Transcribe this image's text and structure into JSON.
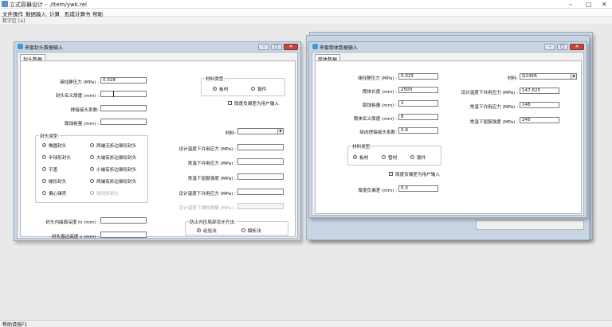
{
  "app": {
    "title": "立式容器设计 - ./Item/ywk.rel",
    "window_controls": {
      "minimize": "–",
      "maximize": "□",
      "close": "✕"
    }
  },
  "menu": [
    "文件操作",
    "数据输入",
    "计算",
    "形成计算书",
    "帮助"
  ],
  "toolbar": {
    "text": "数字区 [a]"
  },
  "status": {
    "text": "帮助请按F1"
  },
  "head_window": {
    "title": "夹套封头数据输入",
    "tab": "封头数据",
    "fields": [
      {
        "label": "液柱静压力 (MPa) :",
        "value": "0.028"
      },
      {
        "label": "封头名义厚度 (mm) :",
        "value": ""
      },
      {
        "label": "焊接接头系数:",
        "value": ""
      },
      {
        "label": "腐蚀裕量 (mm) :",
        "value": ""
      }
    ],
    "head_type_group": {
      "title": "封头类型:",
      "left": [
        {
          "label": "椭圆封头",
          "checked": true
        },
        {
          "label": "半球形封头",
          "checked": false
        },
        {
          "label": "平盖",
          "checked": false
        },
        {
          "label": "碟形封头",
          "checked": false
        },
        {
          "label": "偏心锥壳",
          "checked": false
        }
      ],
      "right": [
        {
          "label": "两端无折边锥形封头",
          "checked": false
        },
        {
          "label": "大端有折边锥形封头",
          "checked": false
        },
        {
          "label": "小端有折边锥形封头",
          "checked": false
        },
        {
          "label": "两端有折边锥形封头",
          "checked": false
        },
        {
          "label": "球冠形封头",
          "checked": false,
          "disabled": true
        }
      ]
    },
    "depth_fields": [
      {
        "label": "封头内曲面深度 hi (mm) :",
        "value": ""
      },
      {
        "label": "封头直边高度 c (mm) :",
        "value": ""
      }
    ],
    "material_type_group": {
      "title": "材料类型:",
      "options": [
        {
          "label": "板材",
          "checked": true
        },
        {
          "label": "锻件",
          "checked": false
        }
      ]
    },
    "thickness_neg_checkbox": {
      "label": "厚度负偏差为用户输入",
      "checked": false
    },
    "material_label": "材料:",
    "material_value": "",
    "stress_fields": [
      {
        "label": "设计温度下许用应力 (MPa) :",
        "value": "",
        "disabled": false
      },
      {
        "label": "常温下许用应力 (MPa) :",
        "value": "",
        "disabled": false
      },
      {
        "label": "常温下屈服强度 (MPa) :",
        "value": "",
        "disabled": false
      },
      {
        "label": "设计温度下许用应力 (MPa) :",
        "value": "",
        "disabled": false
      },
      {
        "label": "设计温度下弹性模量 (MPa) :",
        "value": "",
        "disabled": true
      }
    ],
    "pressure_method_group": {
      "title": "防止内压局部设计方法:",
      "options": [
        {
          "label": "经验法",
          "checked": true
        },
        {
          "label": "解析法",
          "checked": false
        }
      ]
    }
  },
  "shell_window": {
    "title": "夹套筒体数据输入",
    "tab": "筒体数据",
    "fields": [
      {
        "label": "液柱静压力 (MPa) :",
        "value": "0.025"
      },
      {
        "label": "筒体长度 (mm) :",
        "value": "2500"
      },
      {
        "label": "腐蚀裕量 (mm) :",
        "value": "2"
      },
      {
        "label": "筒体名义厚度 (mm) :",
        "value": "8"
      },
      {
        "label": "纵向焊接接头系数:",
        "value": "0.8"
      }
    ],
    "material_label": "材料:",
    "material_value": "Q245R",
    "stress_fields": [
      {
        "label": "设计温度下许用应力 (MPa) :",
        "value": "147.625"
      },
      {
        "label": "常温下许用应力 (MPa) :",
        "value": "148"
      },
      {
        "label": "常温下屈服强度 (MPa) :",
        "value": "245"
      }
    ],
    "material_type_group": {
      "title": "材料类型:",
      "options": [
        {
          "label": "板材",
          "checked": true
        },
        {
          "label": "管材",
          "checked": false
        },
        {
          "label": "锻件",
          "checked": false
        }
      ]
    },
    "thickness_neg_checkbox": {
      "label": "厚度负偏差为用户输入",
      "checked": true
    },
    "neg_field": {
      "label": "厚度负偏差 (mm) :",
      "value": "0.3"
    }
  },
  "colors": {
    "title_bg": "#c9d5e3",
    "close_button": "#c7463a",
    "window_bg": "#f0f0f0",
    "panel_bg": "#ffffff"
  }
}
